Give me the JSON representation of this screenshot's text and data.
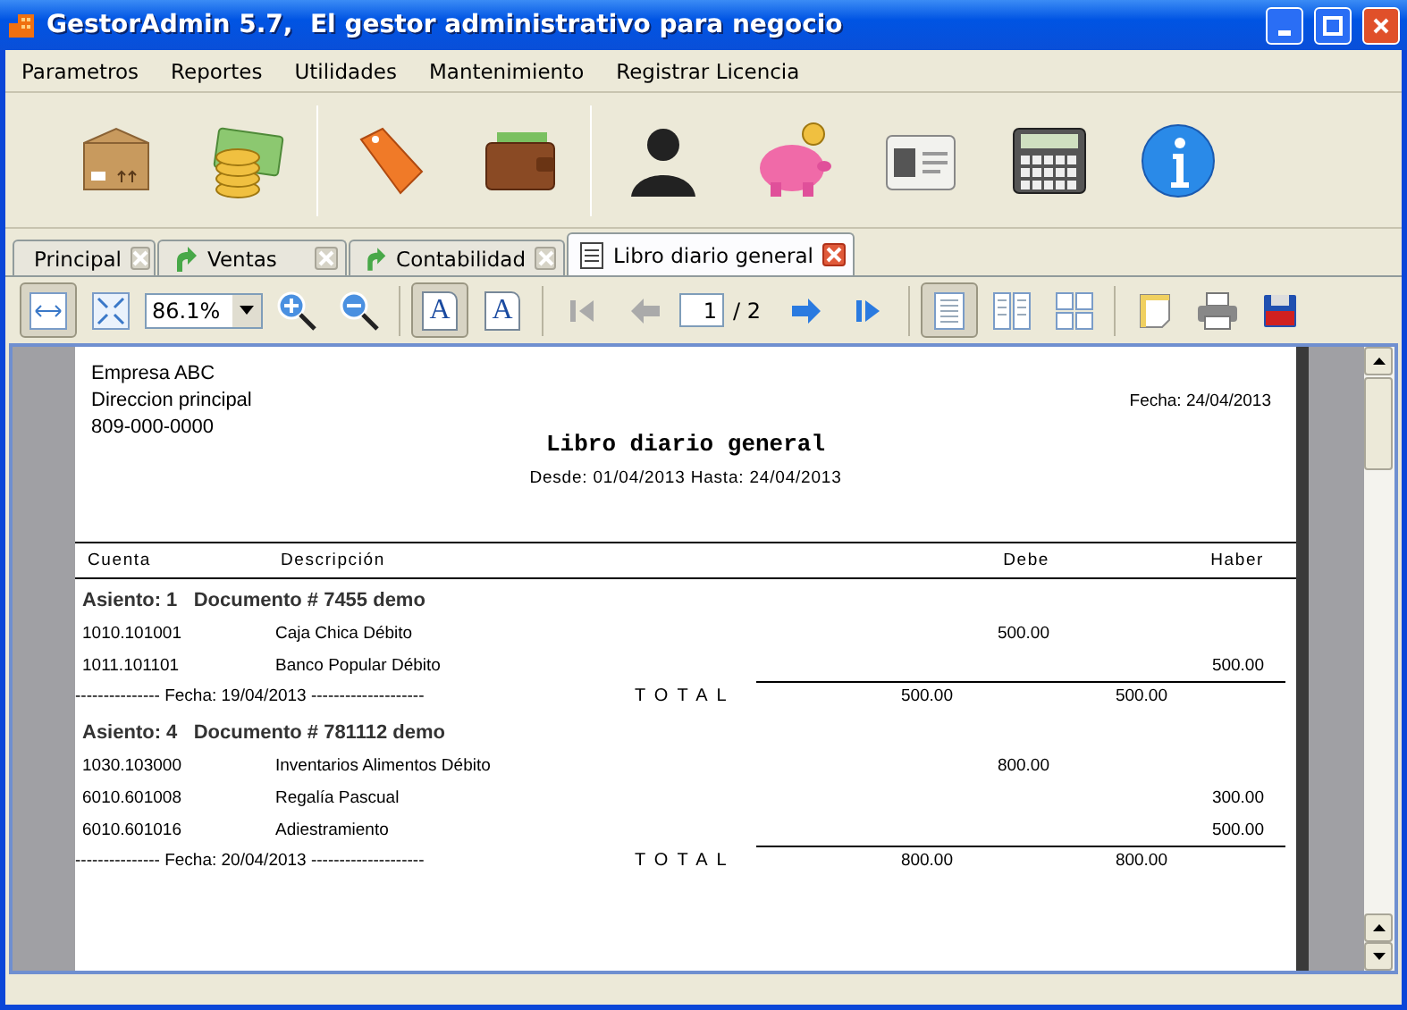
{
  "window": {
    "title": "GestorAdmin 5.7,  El gestor administrativo para negocio"
  },
  "menu": [
    "Parametros",
    "Reportes",
    "Utilidades",
    "Mantenimiento",
    "Registrar Licencia"
  ],
  "tabs": [
    {
      "label": "Principal",
      "kind": "home",
      "selected": false
    },
    {
      "label": "Ventas",
      "kind": "arrow",
      "selected": false
    },
    {
      "label": "Contabilidad",
      "kind": "arrow",
      "selected": false
    },
    {
      "label": "Libro diario general",
      "kind": "document",
      "selected": true
    }
  ],
  "viewer": {
    "fit_width": {
      "selected": true
    },
    "zoom": "86.1%",
    "text_modes": [
      {
        "label": "A",
        "selected": true
      },
      {
        "label": "A",
        "selected": false
      }
    ],
    "page": "1",
    "page_total": "/ 2",
    "view_modes": [
      {
        "selected": true
      },
      {
        "selected": false
      },
      {
        "selected": false
      }
    ]
  },
  "report": {
    "company": [
      "Empresa ABC",
      "Direccion principal",
      "809-000-0000"
    ],
    "date": "Fecha: 24/04/2013",
    "title": "Libro diario general",
    "range": "Desde: 01/04/2013  Hasta: 24/04/2013",
    "columns": [
      "Cuenta",
      "Descripción",
      "Debe",
      "Haber"
    ],
    "entries": [
      {
        "heading": "Asiento: 1   Documento # 7455 demo",
        "lines": [
          {
            "account": "1010.101001",
            "description": "Caja Chica Débito",
            "debit": "500.00"
          },
          {
            "account": "1011.101101",
            "description": "Banco Popular Débito",
            "credit": "500.00"
          }
        ],
        "footer": "--------------- Fecha: 19/04/2013 --------------------",
        "total_label": "TOTAL",
        "total_debit": "500.00",
        "total_credit": "500.00"
      },
      {
        "heading": "Asiento: 4   Documento # 781112 demo",
        "lines": [
          {
            "account": "1030.103000",
            "description": "Inventarios Alimentos Débito",
            "debit": "800.00"
          },
          {
            "account": "6010.601008",
            "description": "Regalía Pascual",
            "credit": "300.00"
          },
          {
            "account": "6010.601016",
            "description": "Adiestramiento",
            "credit": "500.00"
          }
        ],
        "footer": "--------------- Fecha: 20/04/2013 --------------------",
        "total_label": "TOTAL",
        "total_debit": "800.00",
        "total_credit": "800.00"
      }
    ]
  }
}
